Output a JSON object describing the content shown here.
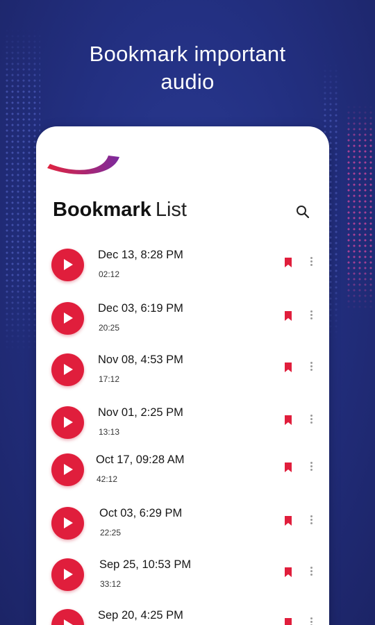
{
  "headline": {
    "line1": "Bookmark important",
    "line2": "audio"
  },
  "list": {
    "title_bold": "Bookmark",
    "title_light": "List"
  },
  "colors": {
    "accent": "#e01e3c",
    "background": "#233082",
    "swoosh_start": "#e0233f",
    "swoosh_end": "#7b2a9e"
  },
  "icons": {
    "search": "search-icon",
    "play": "play-icon",
    "bookmark": "bookmark-icon",
    "more": "more-vert-icon"
  },
  "recordings": [
    {
      "date": "Dec 13, 8:28 PM",
      "duration": "02:12"
    },
    {
      "date": "Dec 03, 6:19 PM",
      "duration": "20:25"
    },
    {
      "date": "Nov 08, 4:53 PM",
      "duration": "17:12"
    },
    {
      "date": "Nov 01, 2:25 PM",
      "duration": "13:13"
    },
    {
      "date": "Oct 17, 09:28 AM",
      "duration": "42:12"
    },
    {
      "date": "Oct 03, 6:29 PM",
      "duration": "22:25"
    },
    {
      "date": "Sep 25, 10:53 PM",
      "duration": "33:12"
    },
    {
      "date": "Sep 20, 4:25 PM",
      "duration": ""
    }
  ]
}
